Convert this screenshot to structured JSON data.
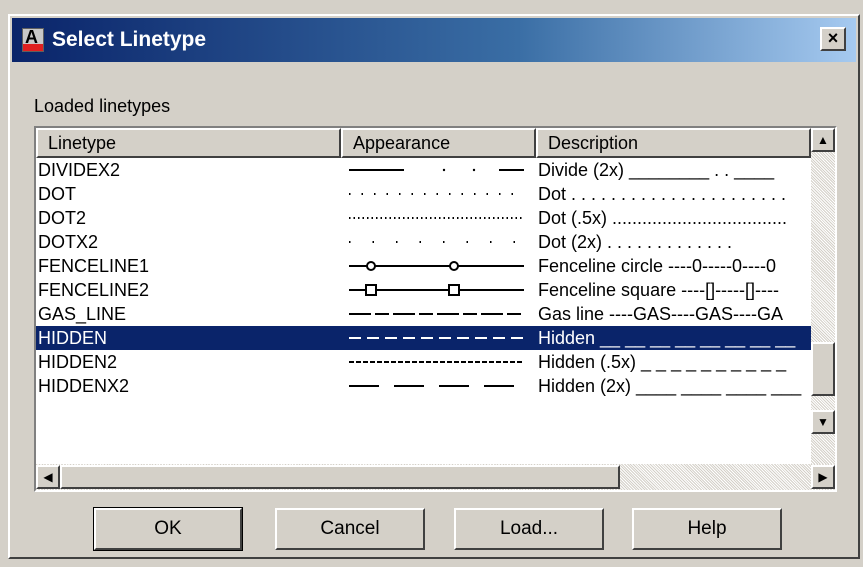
{
  "window": {
    "title": "Select Linetype",
    "app_icon_letter": "A",
    "close_label": "×"
  },
  "section_label": "Loaded linetypes",
  "columns": [
    "Linetype",
    "Appearance",
    "Description"
  ],
  "rows": [
    {
      "name": "DIVIDEX2",
      "description": "Divide (2x) ________ . . ____",
      "pattern": "dividex2",
      "selected": false
    },
    {
      "name": "DOT",
      "description": "Dot . . . . . . . . . . . . . . . . . . . . . .",
      "pattern": "dot",
      "selected": false
    },
    {
      "name": "DOT2",
      "description": "Dot (.5x) ...................................",
      "pattern": "dot2",
      "selected": false
    },
    {
      "name": "DOTX2",
      "description": "Dot (2x) . . . . . . . . . . . . .",
      "pattern": "dotx2",
      "selected": false
    },
    {
      "name": "FENCELINE1",
      "description": "Fenceline circle ----0-----0----0",
      "pattern": "fence1",
      "selected": false
    },
    {
      "name": "FENCELINE2",
      "description": "Fenceline square ----[]-----[]----",
      "pattern": "fence2",
      "selected": false
    },
    {
      "name": "GAS_LINE",
      "description": "Gas line ----GAS----GAS----GA",
      "pattern": "gas",
      "selected": false
    },
    {
      "name": "HIDDEN",
      "description": "Hidden __ __ __ __ __ __ __ __",
      "pattern": "hidden",
      "selected": true
    },
    {
      "name": "HIDDEN2",
      "description": "Hidden (.5x) _ _ _ _ _ _ _ _ _ _",
      "pattern": "hidden2",
      "selected": false
    },
    {
      "name": "HIDDENX2",
      "description": "Hidden (2x) ____ ____ ____ ___",
      "pattern": "hiddenx2",
      "selected": false
    }
  ],
  "buttons": {
    "ok": "OK",
    "cancel": "Cancel",
    "load": "Load...",
    "help": "Help"
  },
  "scroll": {
    "up": "▲",
    "down": "▼",
    "left": "◀",
    "right": "▶"
  },
  "colors": {
    "title_start": "#0a246a",
    "selection": "#0a246a",
    "face": "#d4d0c8"
  }
}
